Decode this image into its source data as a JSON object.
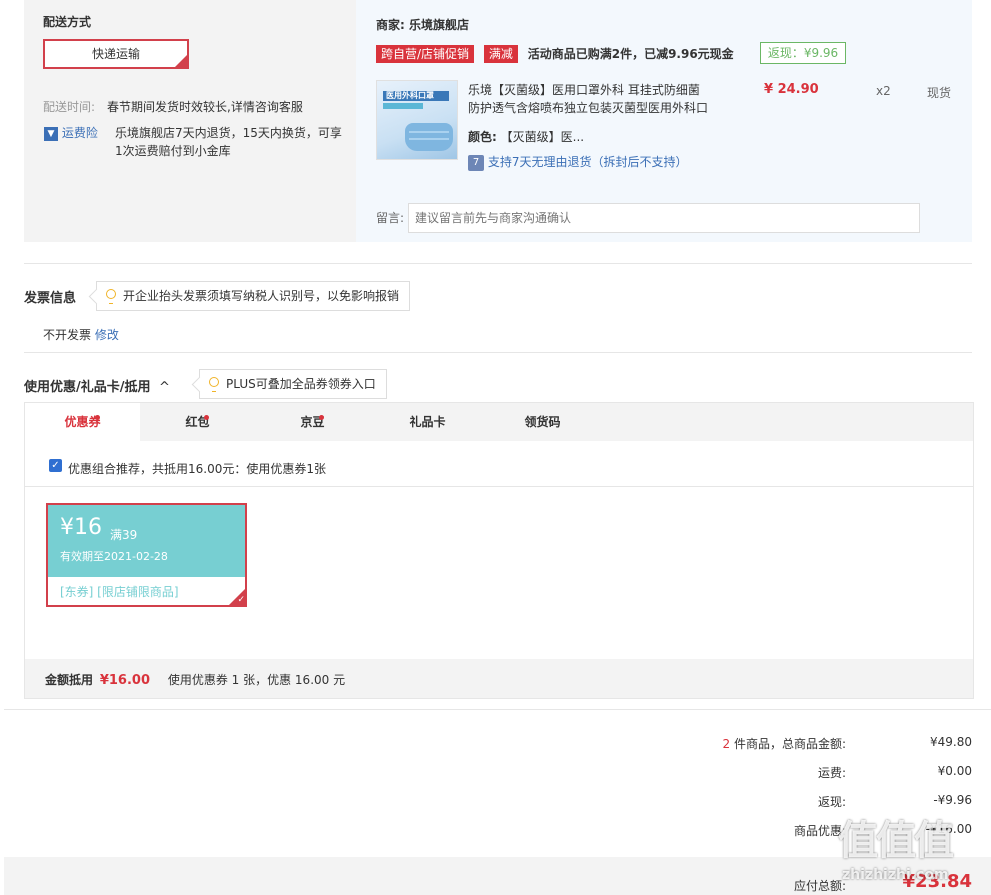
{
  "delivery": {
    "title": "配送方式",
    "method": "快递运输",
    "time_label": "配送时间:",
    "time_value": "春节期间发货时效较长,详情咨询客服",
    "insurance_icon": "▼",
    "insurance_label": "运费险",
    "insurance_text_1": "乐境旗舰店7天内退货，15天内换货，可享",
    "insurance_text_2": "1次运费赔付到小金库"
  },
  "merchant": {
    "label": "商家:",
    "name": "乐境旗舰店",
    "tag1": "跨自营/店铺促销",
    "tag2": "满减",
    "promo_text": "活动商品已购满2件，已减9.96元现金",
    "rebate": "返现：¥9.96",
    "product": {
      "image_text": "医用外科口罩",
      "title_line1": "乐境【灭菌级】医用口罩外科 耳挂式防细菌",
      "title_line2": "防护透气含熔喷布独立包装灭菌型医用外科口",
      "color_label": "颜色:",
      "color_value": "【灭菌级】医...",
      "price": "¥ 24.90",
      "qty": "x2",
      "stock": "现货",
      "return_icon": "7",
      "return_text": "支持7天无理由退货（拆封后不支持）"
    },
    "message_label": "留言:",
    "message_placeholder": "建议留言前先与商家沟通确认"
  },
  "invoice": {
    "title": "发票信息",
    "tip": "开企业抬头发票须填写纳税人识别号，以免影响报销",
    "status": "不开发票",
    "edit": "修改"
  },
  "coupon": {
    "title": "使用优惠/礼品卡/抵用",
    "arrow": "^",
    "tip": "PLUS可叠加全品券领券入口",
    "tabs": [
      "优惠券",
      "红包",
      "京豆",
      "礼品卡",
      "领货码"
    ],
    "check_mark": "✓",
    "recommend": "优惠组合推荐，共抵用16.00元：使用优惠券1张",
    "card": {
      "amount": "¥16",
      "condition": "满39",
      "expiry": "有效期至2021-02-28",
      "tags": "[东券]  [限店铺限商品]"
    },
    "footer_label": "金额抵用",
    "footer_amount": "¥16.00",
    "footer_desc": "使用优惠券 1 张，优惠 16.00 元"
  },
  "summary": {
    "count": "2",
    "total_label": "件商品，总商品金额:",
    "total": "¥49.80",
    "shipping_label": "运费:",
    "shipping": "¥0.00",
    "rebate_label": "返现:",
    "rebate": "-¥9.96",
    "discount_label": "商品优惠:",
    "discount": "-¥16.00",
    "pay_label": "应付总额:",
    "pay": "¥23.84"
  },
  "watermark": {
    "logo": "值值值",
    "site": "zhizhizhi.com"
  },
  "colors": {
    "accent_red": "#d9333c",
    "link_blue": "#3b6fb6",
    "rebate_green": "#6bb765",
    "coupon_teal": "#77cfd2"
  }
}
